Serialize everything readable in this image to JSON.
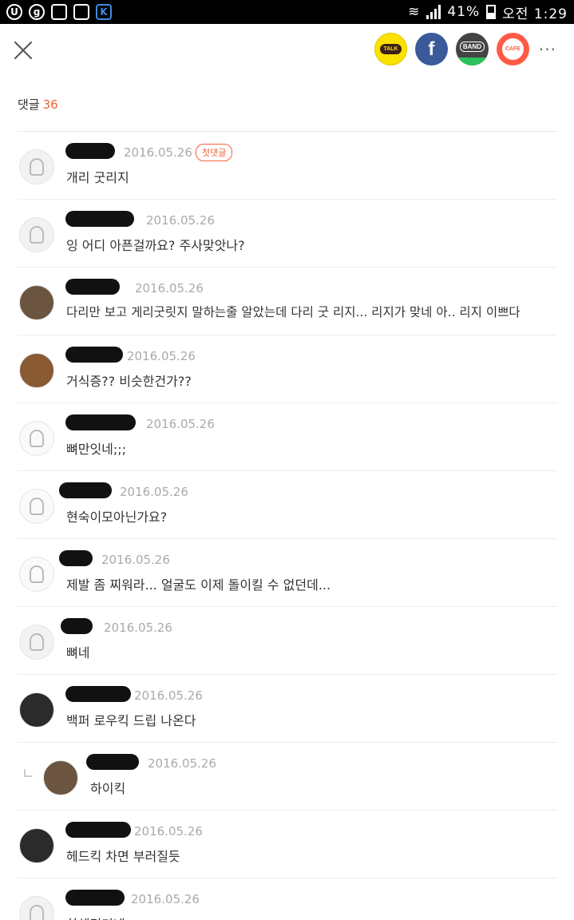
{
  "status_bar": {
    "left_icons": [
      "U",
      "g",
      "doc-icon",
      "image-icon",
      "k-icon"
    ],
    "battery": "41%",
    "time": "오전 1:29"
  },
  "header": {
    "close": "close-icon",
    "shares": [
      {
        "name": "kakaotalk",
        "label": "TALK"
      },
      {
        "name": "facebook",
        "label": "f"
      },
      {
        "name": "band",
        "label": "BAND"
      },
      {
        "name": "cafe",
        "label": "CAFE"
      }
    ],
    "more": "···"
  },
  "comment_count": {
    "label": "댓글",
    "value": "36"
  },
  "comments": [
    {
      "date": "2016.05.26",
      "badge": "첫댓글",
      "text": "개리 굿리지"
    },
    {
      "date": "2016.05.26",
      "text": "잉 어디 아픈걸까요? 주사맞앗나?"
    },
    {
      "date": "2016.05.26",
      "text": "다리만 보고 게리굿릿지 말하는줄 알았는데 다리 굿 리지... 리지가 맞네 아.. 리지 이쁘다"
    },
    {
      "date": "2016.05.26",
      "text": "거식증?? 비슷한건가??"
    },
    {
      "date": "2016.05.26",
      "text": "뼈만잇네;;;"
    },
    {
      "date": "2016.05.26",
      "text": "현숙이모아닌가요?"
    },
    {
      "date": "2016.05.26",
      "text": "제발 좀 찌워라... 얼굴도 이제 돌이킬 수 없던데..."
    },
    {
      "date": "2016.05.26",
      "text": "뼈네"
    },
    {
      "date": "2016.05.26",
      "text": "백퍼 로우킥 드립 나온다"
    },
    {
      "date": "2016.05.26",
      "text": "하이킥"
    },
    {
      "date": "2016.05.26",
      "text": "헤드킥 차면 부러질듯"
    },
    {
      "date": "2016.05.26",
      "text": "하체딘기네"
    }
  ]
}
